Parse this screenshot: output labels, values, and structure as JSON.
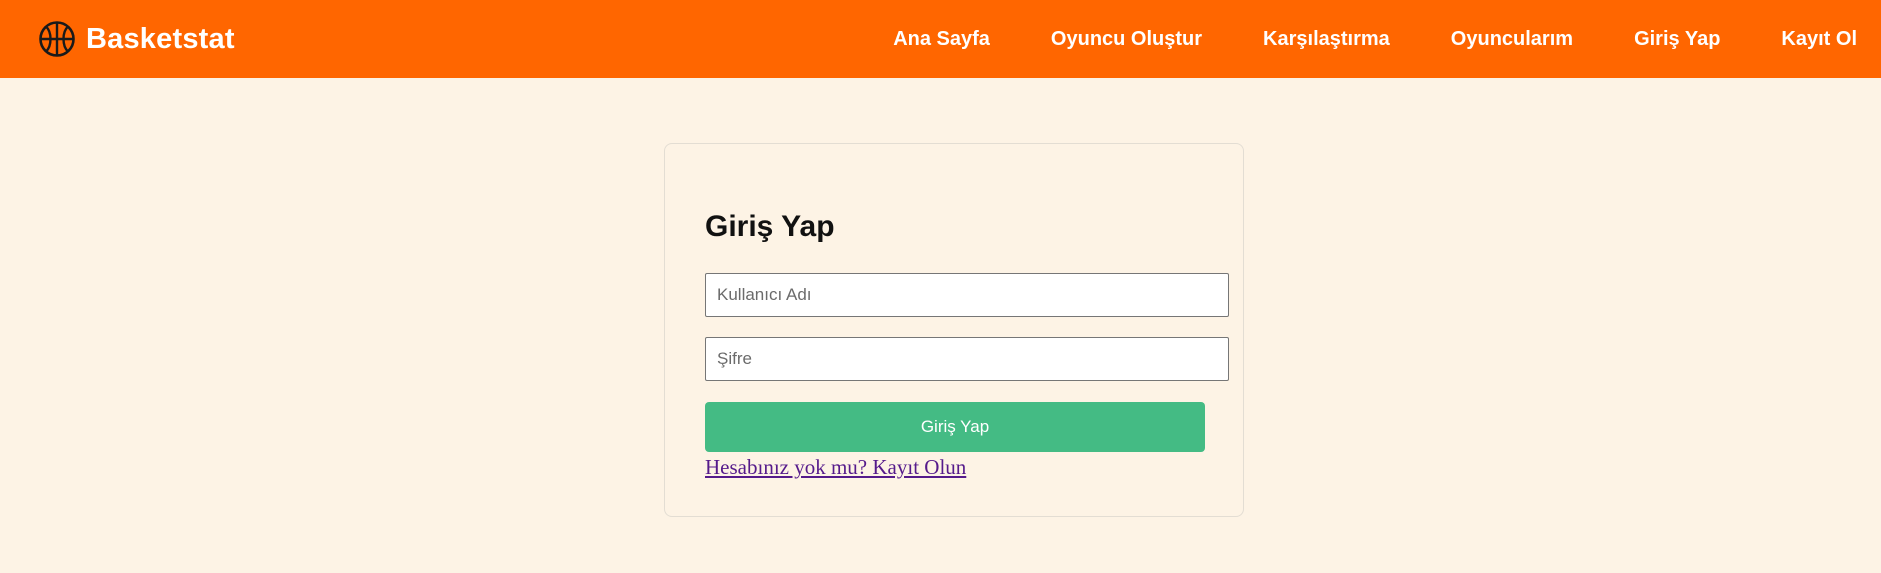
{
  "brand": {
    "name": "Basketstat",
    "icon": "basketball-icon"
  },
  "nav": {
    "items": [
      {
        "label": "Ana Sayfa"
      },
      {
        "label": "Oyuncu Oluştur"
      },
      {
        "label": "Karşılaştırma"
      },
      {
        "label": "Oyuncularım"
      },
      {
        "label": "Giriş Yap"
      },
      {
        "label": "Kayıt Ol"
      }
    ]
  },
  "login": {
    "title": "Giriş Yap",
    "username": {
      "placeholder": "Kullanıcı Adı",
      "value": ""
    },
    "password": {
      "placeholder": "Şifre",
      "value": ""
    },
    "submit_label": "Giriş Yap",
    "register_link": "Hesabınız yok mu? Kayıt Olun"
  },
  "colors": {
    "navbar": "#ff6600",
    "page_background": "#fdf3e5",
    "button": "#44bb84",
    "link": "#551a8b"
  }
}
